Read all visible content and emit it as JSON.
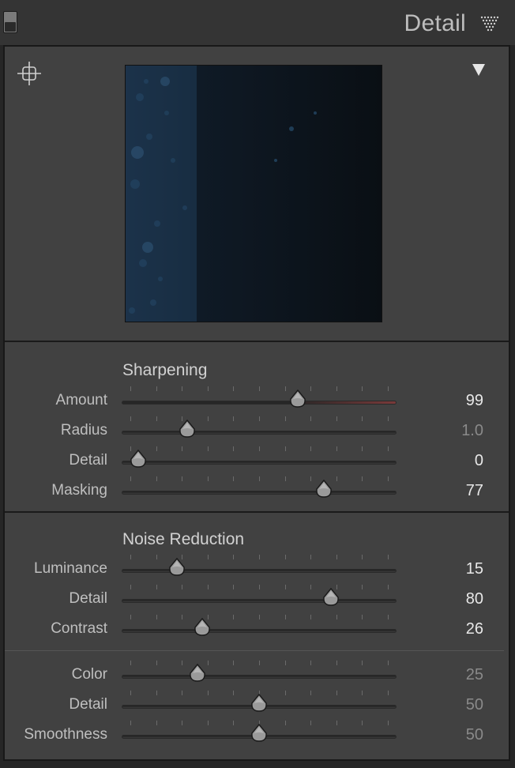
{
  "header": {
    "title": "Detail"
  },
  "sharpening": {
    "title": "Sharpening",
    "sliders": [
      {
        "label": "Amount",
        "value": "99",
        "fraction": 0.65,
        "dim": false,
        "red": true
      },
      {
        "label": "Radius",
        "value": "1.0",
        "fraction": 0.22,
        "dim": true,
        "red": false
      },
      {
        "label": "Detail",
        "value": "0",
        "fraction": 0.03,
        "dim": false,
        "red": false
      },
      {
        "label": "Masking",
        "value": "77",
        "fraction": 0.75,
        "dim": false,
        "red": false
      }
    ]
  },
  "noise_reduction": {
    "title": "Noise Reduction",
    "luminance_sliders": [
      {
        "label": "Luminance",
        "value": "15",
        "fraction": 0.18,
        "dim": false
      },
      {
        "label": "Detail",
        "value": "80",
        "fraction": 0.78,
        "dim": false
      },
      {
        "label": "Contrast",
        "value": "26",
        "fraction": 0.28,
        "dim": false
      }
    ],
    "color_sliders": [
      {
        "label": "Color",
        "value": "25",
        "fraction": 0.26,
        "dim": true
      },
      {
        "label": "Detail",
        "value": "50",
        "fraction": 0.5,
        "dim": true
      },
      {
        "label": "Smoothness",
        "value": "50",
        "fraction": 0.5,
        "dim": true
      }
    ]
  },
  "colors": {
    "panel_bg": "#414141",
    "header_bg": "#343434",
    "accent_red": "#7a3a3a"
  }
}
